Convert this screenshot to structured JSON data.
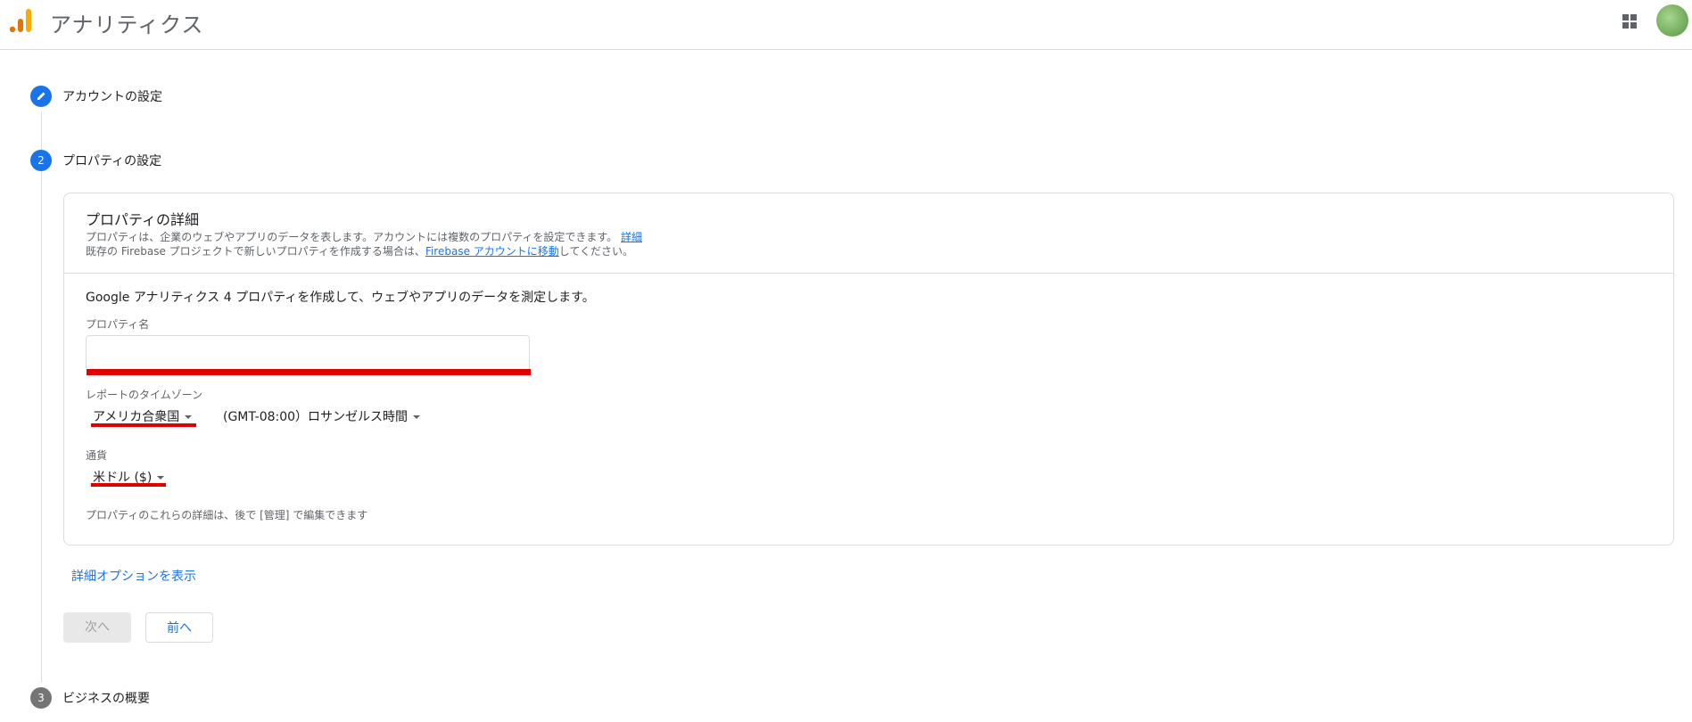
{
  "header": {
    "app_title": "アナリティクス",
    "logo_icon": "analytics-logo-icon",
    "apps_icon": "apps-grid-icon",
    "avatar_icon": "user-avatar"
  },
  "steps": [
    {
      "number": "",
      "icon": "pencil-icon",
      "label": "アカウントの設定",
      "state": "done"
    },
    {
      "number": "2",
      "label": "プロパティの設定",
      "state": "active"
    },
    {
      "number": "3",
      "label": "ビジネスの概要",
      "state": "pending"
    }
  ],
  "property_details": {
    "title": "プロパティの詳細",
    "desc_line1": "プロパティは、企業のウェブやアプリのデータを表します。アカウントには複数のプロパティを設定できます。",
    "desc_line1_link": "詳細",
    "desc_line2_prefix": "既存の Firebase プロジェクトで新しいプロパティを作成する場合は、",
    "desc_line2_link": "Firebase アカウントに移動",
    "desc_line2_suffix": "してください。",
    "ga4_text": "Google アナリティクス 4 プロパティを作成して、ウェブやアプリのデータを測定します。",
    "property_name_label": "プロパティ名",
    "property_name_value": "",
    "timezone_label": "レポートのタイムゾーン",
    "timezone_country": "アメリカ合衆国",
    "timezone_value": "(GMT-08:00）ロサンゼルス時間",
    "currency_label": "通貨",
    "currency_value": "米ドル ($)",
    "footnote": "プロパティのこれらの詳細は、後で [管理] で編集できます"
  },
  "actions": {
    "advanced_options": "詳細オプションを表示",
    "next": "次へ",
    "back": "前へ"
  },
  "colors": {
    "accent": "#1a73e8",
    "highlight": "#e00000",
    "logo_orange": "#f9ab00",
    "logo_dark_orange": "#e37400"
  }
}
